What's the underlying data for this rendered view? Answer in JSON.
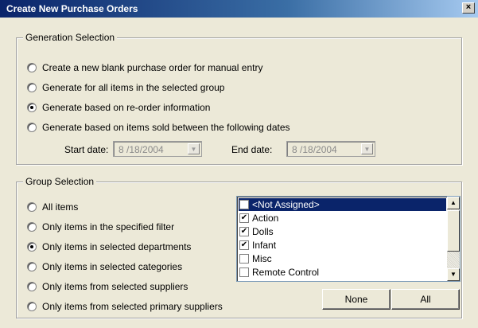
{
  "window": {
    "title": "Create New Purchase Orders",
    "close_glyph": "×"
  },
  "generation": {
    "legend": "Generation Selection",
    "options": [
      {
        "label": "Create a new blank purchase order for manual entry",
        "checked": false
      },
      {
        "label": "Generate for all items in the selected group",
        "checked": false
      },
      {
        "label": "Generate based on re-order information",
        "checked": true
      },
      {
        "label": "Generate based on items sold between the following dates",
        "checked": false
      }
    ],
    "start_label": "Start date:",
    "start_value": "8 /18/2004",
    "end_label": "End date:",
    "end_value": "8 /18/2004"
  },
  "group": {
    "legend": "Group Selection",
    "options": [
      {
        "label": "All items",
        "checked": false
      },
      {
        "label": "Only items in the specified filter",
        "checked": false
      },
      {
        "label": "Only items in selected departments",
        "checked": true
      },
      {
        "label": "Only items in selected categories",
        "checked": false
      },
      {
        "label": "Only items from selected suppliers",
        "checked": false
      },
      {
        "label": "Only items from selected primary suppliers",
        "checked": false
      }
    ],
    "list_items": [
      {
        "label": "<Not Assigned>",
        "checked": false,
        "selected": true
      },
      {
        "label": "Action",
        "checked": true,
        "selected": false
      },
      {
        "label": "Dolls",
        "checked": true,
        "selected": false
      },
      {
        "label": "Infant",
        "checked": true,
        "selected": false
      },
      {
        "label": "Misc",
        "checked": false,
        "selected": false
      },
      {
        "label": "Remote Control",
        "checked": false,
        "selected": false
      }
    ],
    "none_label": "None",
    "all_label": "All"
  },
  "icons": {
    "check": "✔",
    "up_arrow": "▲",
    "down_arrow": "▼",
    "dropdown_arrow": "▼"
  }
}
